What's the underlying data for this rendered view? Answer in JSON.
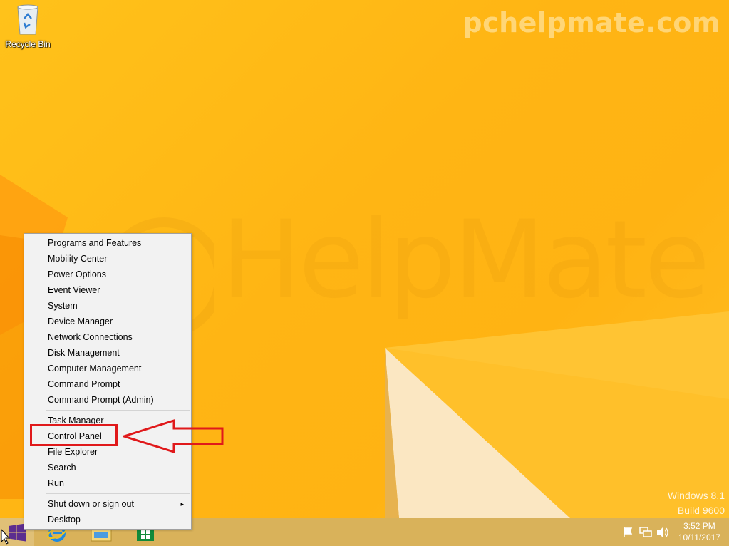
{
  "desktop": {
    "watermark": "pchelpmate.com",
    "logo_text": "HelpMate",
    "recycle_bin_label": "Recycle Bin",
    "os_name": "Windows 8.1",
    "os_build": "Build 9600"
  },
  "menu": {
    "items": [
      "Programs and Features",
      "Mobility Center",
      "Power Options",
      "Event Viewer",
      "System",
      "Device Manager",
      "Network Connections",
      "Disk Management",
      "Computer Management",
      "Command Prompt",
      "Command Prompt (Admin)",
      "Task Manager",
      "Control Panel",
      "File Explorer",
      "Search",
      "Run",
      "Shut down or sign out",
      "Desktop"
    ],
    "submenu_arrow": "▸"
  },
  "taskbar": {
    "icons": [
      "windows-start-icon",
      "internet-explorer-icon",
      "file-explorer-icon",
      "store-icon"
    ],
    "tray_icons": [
      "action-center-flag-icon",
      "network-icon",
      "volume-icon"
    ],
    "time": "3:52 PM",
    "date": "10/11/2017"
  },
  "colors": {
    "desktop_yellow": "#ffb514",
    "taskbar": "#d9b25a",
    "annotation_red": "#e0191b",
    "start_purple": "#5b2d8f"
  }
}
